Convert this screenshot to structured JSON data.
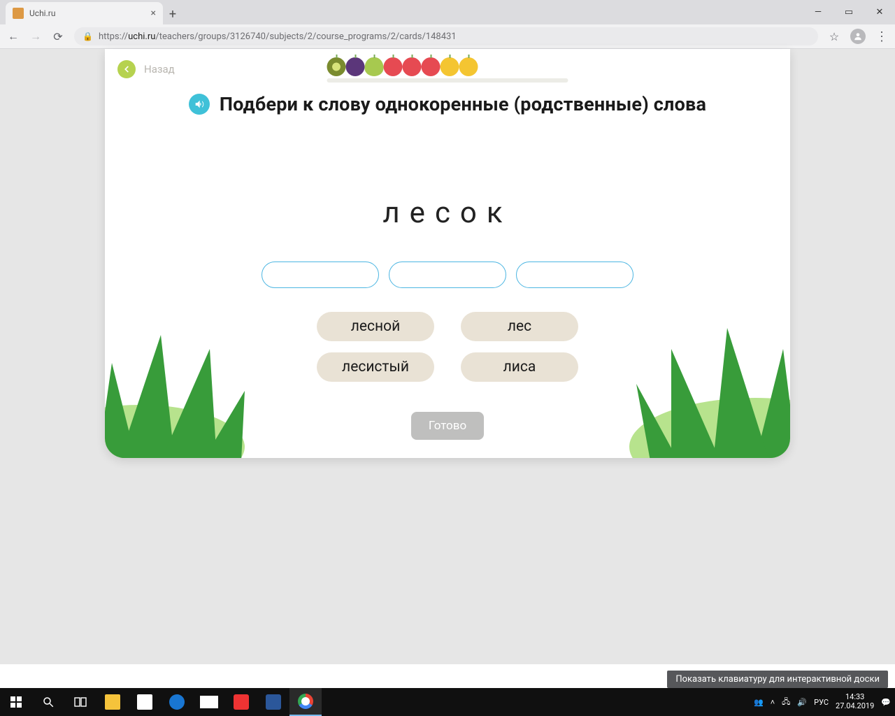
{
  "browser": {
    "tab_title": "Uchi.ru",
    "url_display_prefix": "https://",
    "url_host": "uchi.ru",
    "url_path": "/teachers/groups/3126740/subjects/2/course_programs/2/cards/148431"
  },
  "card": {
    "back_label": "Назад",
    "instruction": "Подбери к слову однокоренные (родственные) слова",
    "target_word": "лесок",
    "options": {
      "row1": [
        "лесной",
        "лес"
      ],
      "row2": [
        "лесистый",
        "лиса"
      ]
    },
    "submit_label": "Готово"
  },
  "tooltip": "Показать клавиатуру для интерактивной доски",
  "tray": {
    "lang": "РУС",
    "time": "14:33",
    "date": "27.04.2019"
  }
}
